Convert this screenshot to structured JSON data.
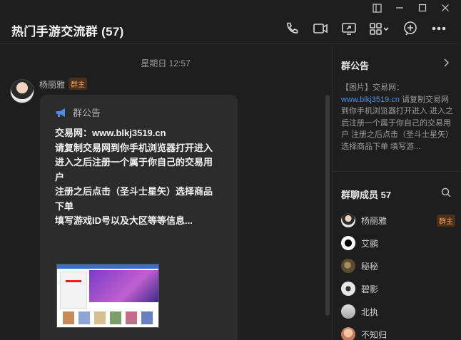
{
  "window": {
    "controls": [
      "sidebar-toggle",
      "minimize",
      "maximize",
      "close"
    ]
  },
  "header": {
    "title": "热门手游交流群 (57)",
    "actions": [
      "phone-icon",
      "video-icon",
      "screen-share-icon",
      "apps-icon",
      "add-icon",
      "more-icon"
    ]
  },
  "chat": {
    "timestamp": "星期日 12:57",
    "message": {
      "sender": "杨丽雅",
      "role": "群主",
      "announcement_label": "群公告",
      "lines": [
        "交易网：www.blkj3519.cn",
        "请复制交易网到你手机浏览器打开进入",
        "进入之后注册一个属于你自己的交易用户",
        "注册之后点击（圣斗士星矢）选择商品下单",
        "填写游戏ID号以及大区等等信息..."
      ]
    }
  },
  "sidebar": {
    "notice_title": "群公告",
    "notice_prefix": "【图片】交易网：",
    "notice_link": "www.blkj3519.cn",
    "notice_rest": " 请复制交易网到你手机浏览器打开进入 进入之后注册一个属于你自己的交易用户 注册之后点击（圣斗士星矢）选择商品下单 填写游...",
    "members_title": "群聊成员 57",
    "members": [
      {
        "name": "杨丽雅",
        "badge": "群主",
        "color": "#e9e4df"
      },
      {
        "name": "艾鹂",
        "badge": "",
        "color": "#f5f5f5"
      },
      {
        "name": "秘秘",
        "badge": "",
        "color": "#6f5a3a"
      },
      {
        "name": "碧影",
        "badge": "",
        "color": "#d9d9d9"
      },
      {
        "name": "北执",
        "badge": "",
        "color": "#c8c8c8"
      },
      {
        "name": "不知归",
        "badge": "",
        "color": "#e0a88a"
      }
    ]
  }
}
